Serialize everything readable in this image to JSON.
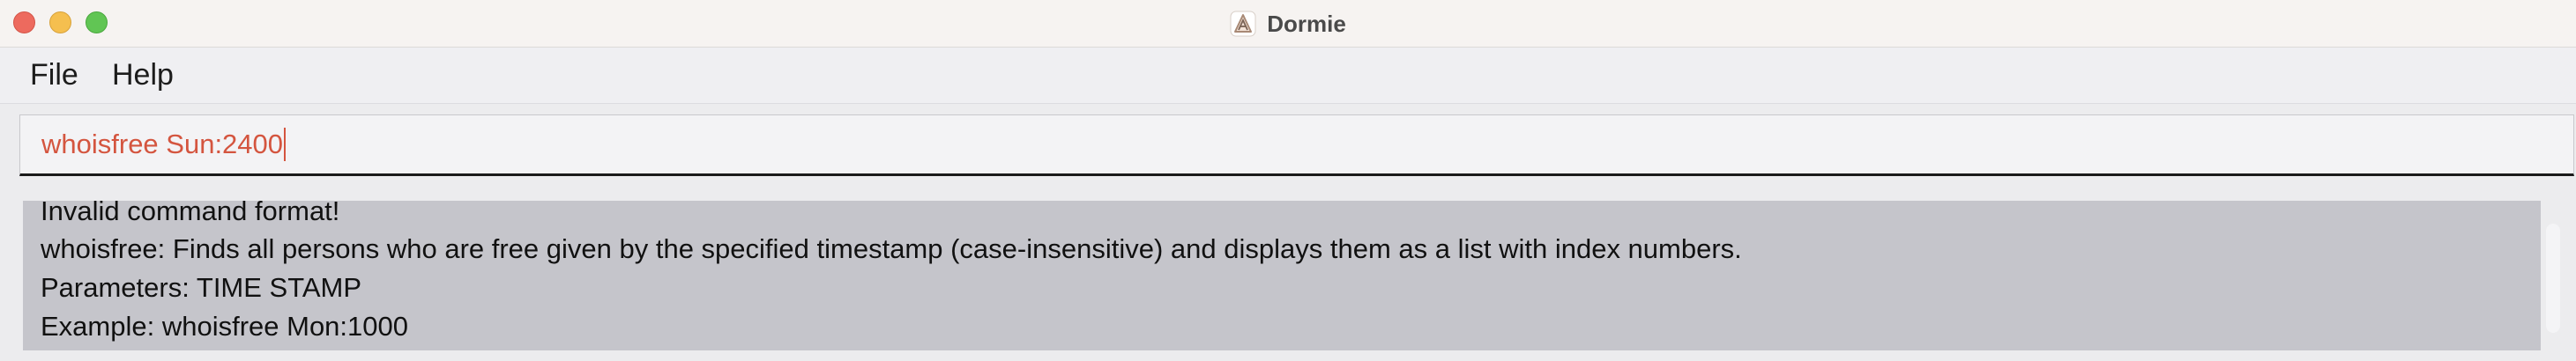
{
  "window": {
    "title": "Dormie",
    "icon": "dormie-app-icon"
  },
  "menu": {
    "file": "File",
    "help": "Help"
  },
  "command_box": {
    "value": "whoisfree Sun:2400"
  },
  "result": {
    "lines": [
      "Invalid command format!",
      "whoisfree: Finds all persons who are free given by the specified timestamp (case-insensitive) and displays them as a list with index numbers.",
      "Parameters: TIME STAMP",
      "Example: whoisfree Mon:1000"
    ]
  },
  "colors": {
    "command_text": "#d4553f",
    "result_background": "#c5c5cb",
    "close": "#ed6a5e",
    "minimize": "#f5bf4f",
    "maximize": "#61c554"
  }
}
